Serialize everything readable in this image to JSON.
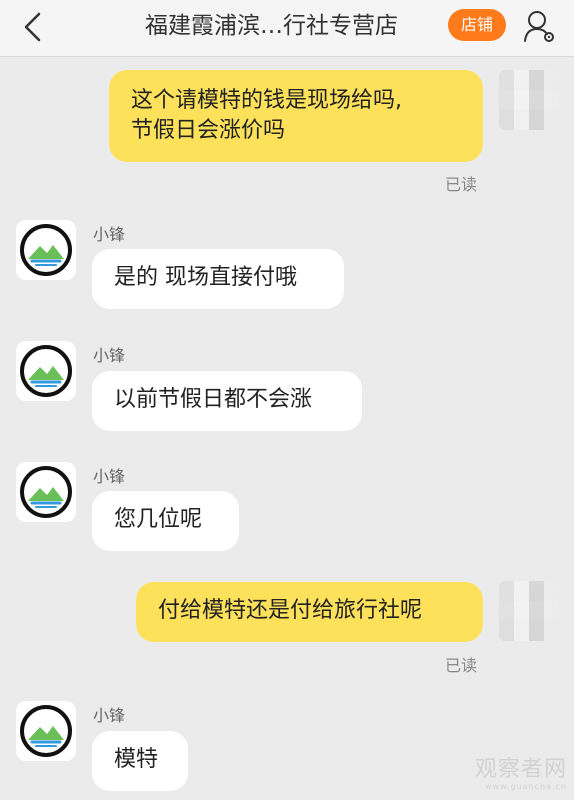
{
  "header": {
    "title": "福建霞浦滨…行社专营店",
    "shop_button": "店铺",
    "icons": {
      "back": "back-chevron-icon",
      "profile": "profile-settings-icon"
    }
  },
  "messages": [
    {
      "sender": "me",
      "lines": [
        "这个请模特的钱是现场给吗,",
        "节假日会涨价吗"
      ],
      "status": "已读"
    },
    {
      "sender": "小锋",
      "lines": [
        "是的 现场直接付哦"
      ]
    },
    {
      "sender": "小锋",
      "lines": [
        "以前节假日都不会涨"
      ]
    },
    {
      "sender": "小锋",
      "lines": [
        "您几位呢"
      ]
    },
    {
      "sender": "me",
      "lines": [
        "付给模特还是付给旅行社呢"
      ],
      "status": "已读"
    },
    {
      "sender": "小锋",
      "lines": [
        "模特"
      ]
    }
  ],
  "watermark": {
    "title": "观察者网",
    "site": "www.guancha.cn"
  },
  "colors": {
    "outgoing_bubble": "#fde15a",
    "incoming_bubble": "#ffffff",
    "shop_button": "#ff7a1a",
    "background": "#ebebeb"
  }
}
